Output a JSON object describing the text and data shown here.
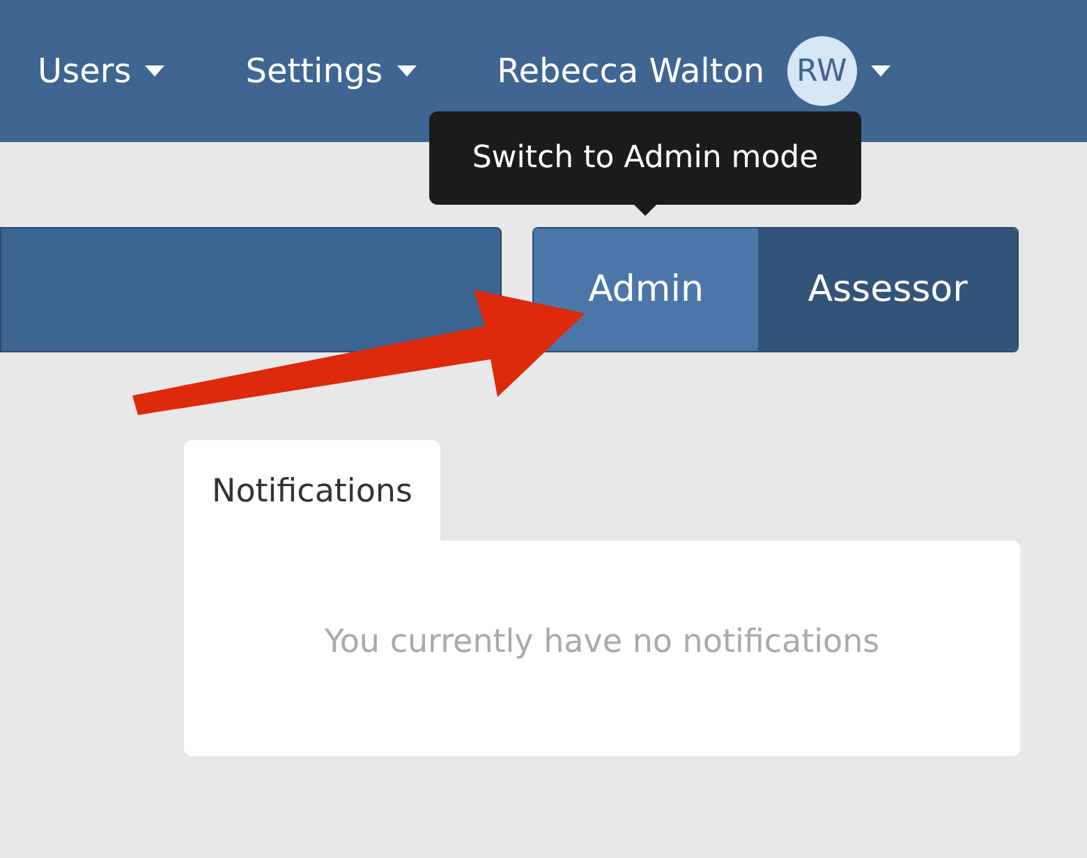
{
  "nav": {
    "items": [
      {
        "label": "Users"
      },
      {
        "label": "Settings"
      }
    ],
    "user": {
      "name": "Rebecca Walton",
      "initials": "RW"
    }
  },
  "tooltip": {
    "text": "Switch to Admin mode"
  },
  "mode_toggle": [
    {
      "label": "Admin",
      "selected": true
    },
    {
      "label": "Assessor",
      "selected": false
    }
  ],
  "notifications": {
    "tab": "Notifications",
    "empty_message": "You currently have no notifications"
  }
}
